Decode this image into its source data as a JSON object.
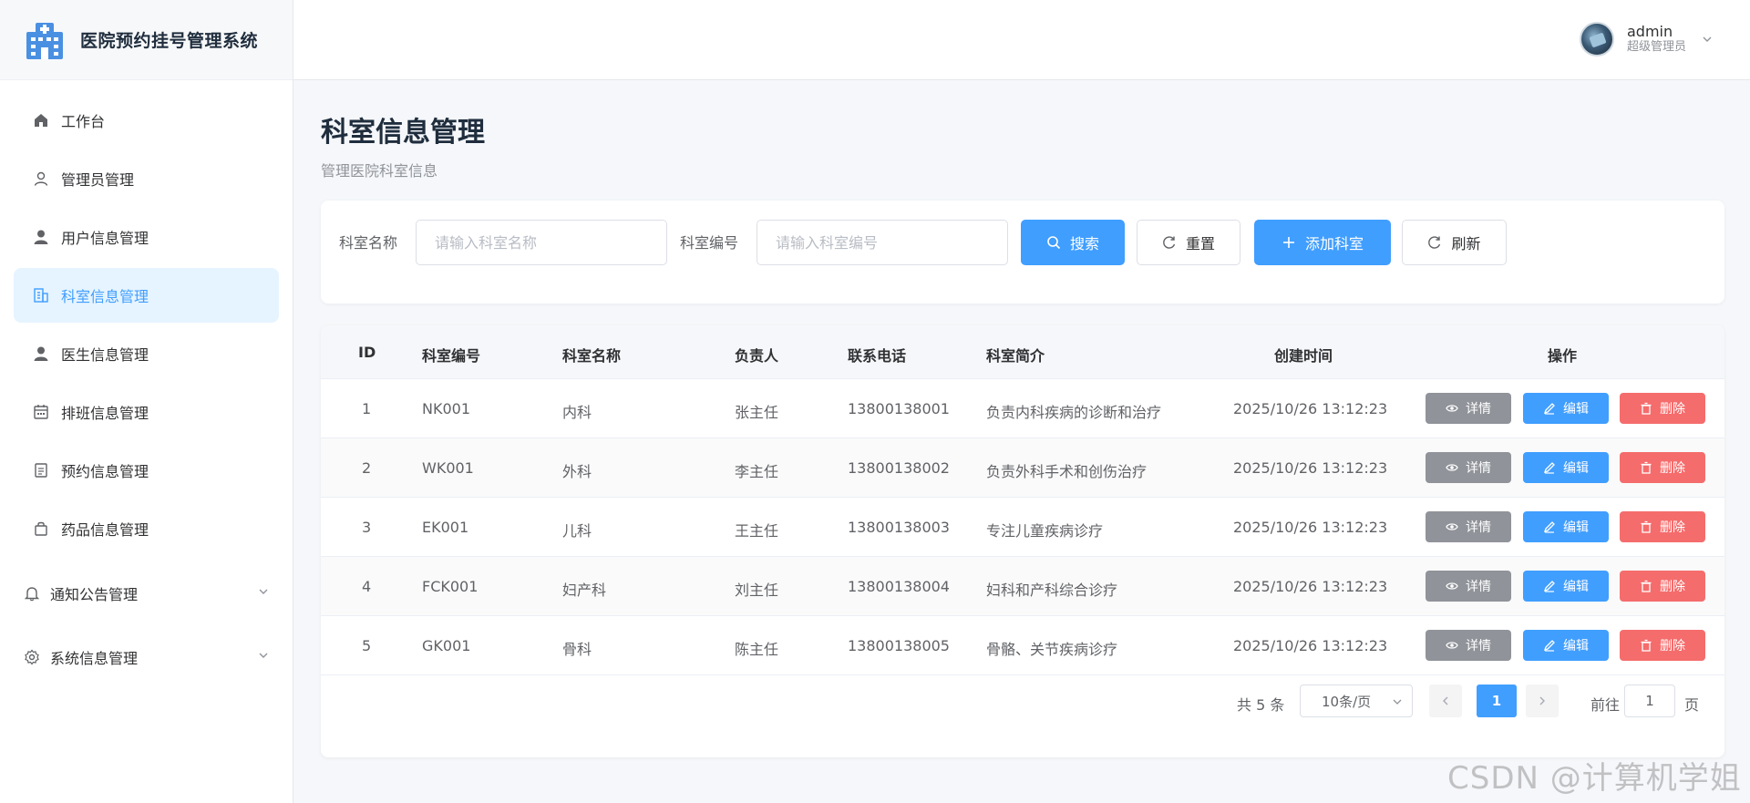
{
  "brand": {
    "title": "医院预约挂号管理系统",
    "logo_icon": "hospital-icon"
  },
  "sidebar": {
    "items": [
      {
        "label": "工作台",
        "icon": "home-icon",
        "active": false
      },
      {
        "label": "管理员管理",
        "icon": "user-outline-icon",
        "active": false
      },
      {
        "label": "用户信息管理",
        "icon": "user-filled-icon",
        "active": false
      },
      {
        "label": "科室信息管理",
        "icon": "building-icon",
        "active": true
      },
      {
        "label": "医生信息管理",
        "icon": "user-filled-icon",
        "active": false
      },
      {
        "label": "排班信息管理",
        "icon": "calendar-icon",
        "active": false
      },
      {
        "label": "预约信息管理",
        "icon": "document-icon",
        "active": false
      },
      {
        "label": "药品信息管理",
        "icon": "bag-icon",
        "active": false
      }
    ],
    "submenus": [
      {
        "label": "通知公告管理",
        "icon": "bell-icon"
      },
      {
        "label": "系统信息管理",
        "icon": "gear-icon"
      }
    ]
  },
  "header": {
    "user_name": "admin",
    "user_role": "超级管理员"
  },
  "page": {
    "title": "科室信息管理",
    "subtitle": "管理医院科室信息"
  },
  "search": {
    "name_label": "科室名称",
    "name_placeholder": "请输入科室名称",
    "code_label": "科室编号",
    "code_placeholder": "请输入科室编号",
    "search_label": "搜索",
    "reset_label": "重置",
    "add_label": "添加科室",
    "refresh_label": "刷新"
  },
  "table": {
    "headers": [
      "ID",
      "科室编号",
      "科室名称",
      "负责人",
      "联系电话",
      "科室简介",
      "创建时间",
      "操作"
    ],
    "rows": [
      {
        "id": "1",
        "code": "NK001",
        "name": "内科",
        "leader": "张主任",
        "phone": "13800138001",
        "intro": "负责内科疾病的诊断和治疗",
        "created": "2025/10/26 13:12:23"
      },
      {
        "id": "2",
        "code": "WK001",
        "name": "外科",
        "leader": "李主任",
        "phone": "13800138002",
        "intro": "负责外科手术和创伤治疗",
        "created": "2025/10/26 13:12:23"
      },
      {
        "id": "3",
        "code": "EK001",
        "name": "儿科",
        "leader": "王主任",
        "phone": "13800138003",
        "intro": "专注儿童疾病诊疗",
        "created": "2025/10/26 13:12:23"
      },
      {
        "id": "4",
        "code": "FCK001",
        "name": "妇产科",
        "leader": "刘主任",
        "phone": "13800138004",
        "intro": "妇科和产科综合诊疗",
        "created": "2025/10/26 13:12:23"
      },
      {
        "id": "5",
        "code": "GK001",
        "name": "骨科",
        "leader": "陈主任",
        "phone": "13800138005",
        "intro": "骨骼、关节疾病诊疗",
        "created": "2025/10/26 13:12:23"
      }
    ],
    "actions": {
      "detail": "详情",
      "edit": "编辑",
      "delete": "删除"
    }
  },
  "pagination": {
    "total": "共 5 条",
    "page_size": "10条/页",
    "current": "1",
    "goto_label": "前往",
    "goto_value": "1",
    "page_suffix": "页"
  },
  "watermark": "CSDN @计算机学姐",
  "colors": {
    "primary": "#409eff",
    "info": "#909399",
    "danger": "#f56c6c",
    "active_bg": "#e6f4ff"
  }
}
